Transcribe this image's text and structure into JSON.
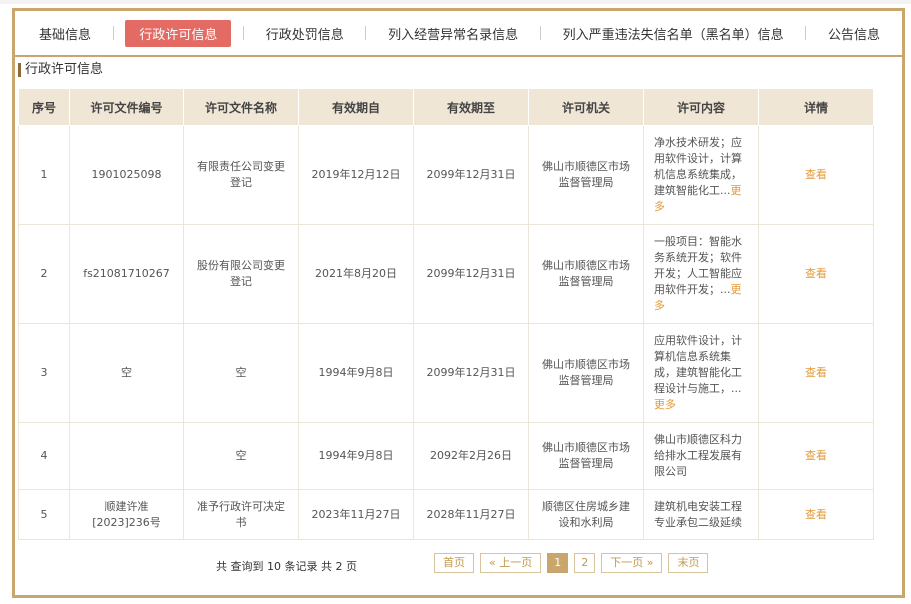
{
  "tabs": [
    "基础信息",
    "行政许可信息",
    "行政处罚信息",
    "列入经营异常名录信息",
    "列入严重违法失信名单（黑名单）信息",
    "公告信息"
  ],
  "section_title": "行政许可信息",
  "columns": [
    "序号",
    "许可文件编号",
    "许可文件名称",
    "有效期自",
    "有效期至",
    "许可机关",
    "许可内容",
    "详情"
  ],
  "rows": [
    {
      "no": "1",
      "code": "1901025098",
      "name": "有限责任公司变更登记",
      "from": "2019年12月12日",
      "to": "2099年12月31日",
      "org": "佛山市顺德区市场监督管理局",
      "content": "净水技术研发；应用软件设计，计算机信息系统集成，建筑智能化工...",
      "more": "更多",
      "detail": "查看"
    },
    {
      "no": "2",
      "code": "fs21081710267",
      "name": "股份有限公司变更登记",
      "from": "2021年8月20日",
      "to": "2099年12月31日",
      "org": "佛山市顺德区市场监督管理局",
      "content": "一般项目：智能水务系统开发；软件开发；人工智能应用软件开发；...",
      "more": "更多",
      "detail": "查看"
    },
    {
      "no": "3",
      "code": "空",
      "name": "空",
      "from": "1994年9月8日",
      "to": "2099年12月31日",
      "org": "佛山市顺德区市场监督管理局",
      "content": "应用软件设计，计算机信息系统集成，建筑智能化工程设计与施工，...",
      "more": "更多",
      "detail": "查看"
    },
    {
      "no": "4",
      "code": "",
      "name": "空",
      "from": "1994年9月8日",
      "to": "2092年2月26日",
      "org": "佛山市顺德区市场监督管理局",
      "content": "佛山市顺德区科力给排水工程发展有限公司",
      "more": "",
      "detail": "查看"
    },
    {
      "no": "5",
      "code": "顺建许准[2023]236号",
      "name": "准予行政许可决定书",
      "from": "2023年11月27日",
      "to": "2028年11月27日",
      "org": "顺德区住房城乡建设和水利局",
      "content": "建筑机电安装工程专业承包二级延续",
      "more": "",
      "detail": "查看"
    }
  ],
  "pager": {
    "info": "共 查询到 10 条记录 共 2 页",
    "first": "首页",
    "prev": "« 上一页",
    "pages": [
      "1",
      "2"
    ],
    "current": "1",
    "next": "下一页 »",
    "last": "末页"
  },
  "colors": {
    "accent": "#c9a66b",
    "active_tab": "#e46a64",
    "link": "#e29a3a",
    "header_bg": "#f0e6d6"
  }
}
